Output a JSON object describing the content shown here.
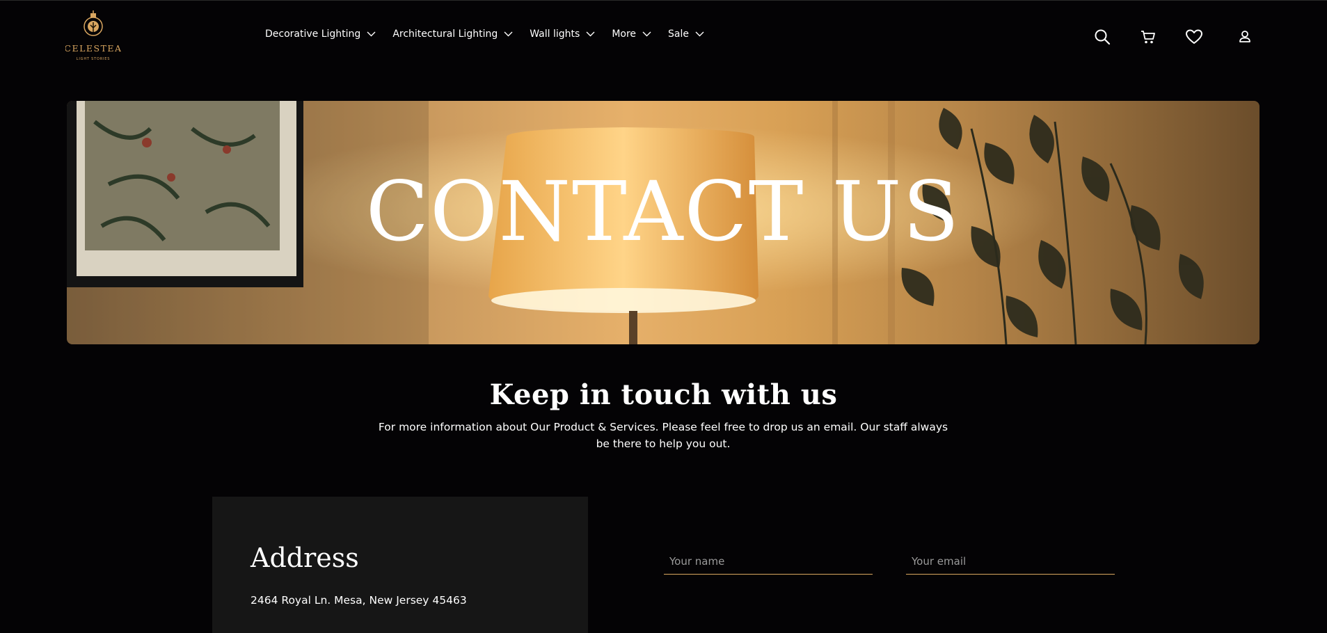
{
  "brand": {
    "name": "CELESTEA",
    "tagline": "LIGHT STORIES",
    "accent_color": "#d9a660"
  },
  "nav": {
    "items": [
      {
        "label": "Decorative Lighting"
      },
      {
        "label": "Architectural Lighting"
      },
      {
        "label": "Wall lights"
      },
      {
        "label": "More"
      },
      {
        "label": "Sale"
      }
    ]
  },
  "header_icons": [
    "search-icon",
    "cart-icon",
    "heart-icon",
    "user-icon"
  ],
  "hero": {
    "title": "CONTACT US"
  },
  "intro": {
    "title": "Keep in touch with us",
    "text": "For more information about Our Product & Services. Please feel free to drop us an email. Our staff always be there to help you out."
  },
  "address": {
    "title": "Address",
    "line": "2464 Royal Ln. Mesa, New Jersey 45463"
  },
  "form": {
    "name_placeholder": "Your name",
    "email_placeholder": "Your email"
  }
}
